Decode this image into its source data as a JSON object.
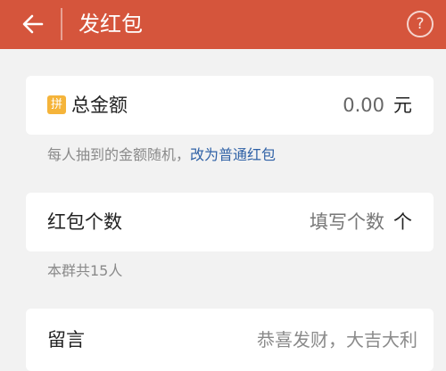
{
  "header": {
    "title": "发红包",
    "back_icon": "arrow-left-icon",
    "help_icon": "question-circle-icon",
    "help_glyph": "?"
  },
  "amount_card": {
    "badge": "拼",
    "label": "总金额",
    "value": "0.00",
    "unit": "元"
  },
  "hint_random": {
    "text": "每人抽到的金额随机，",
    "link": "改为普通红包"
  },
  "count_card": {
    "label": "红包个数",
    "placeholder": "填写个数",
    "unit": "个"
  },
  "hint_group": {
    "text": "本群共15人"
  },
  "message_card": {
    "label": "留言",
    "placeholder": "恭喜发财，大吉大利"
  },
  "colors": {
    "header_bg": "#d5553c",
    "link": "#2f61a6",
    "badge_bg": "#f5b43a"
  }
}
